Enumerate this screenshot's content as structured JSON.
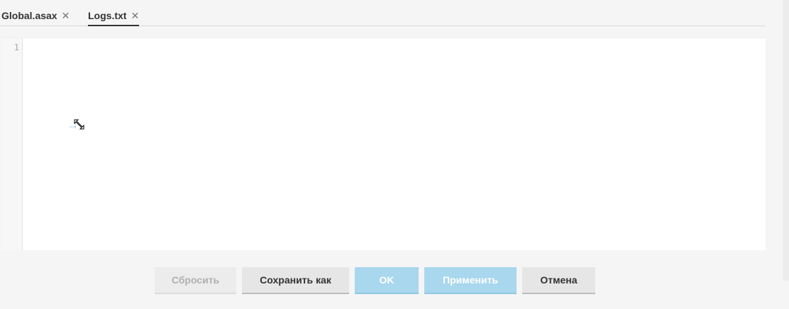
{
  "tabs": [
    {
      "label": "Global.asax",
      "close_icon": "close-icon",
      "active": false
    },
    {
      "label": "Logs.txt",
      "close_icon": "close-icon",
      "active": true
    }
  ],
  "editor": {
    "line_numbers": [
      "1"
    ],
    "content": "",
    "cursor_icon": "resize-cursor-icon"
  },
  "buttons": {
    "reset": {
      "label": "Сбросить",
      "enabled": false
    },
    "save_as": {
      "label": "Сохранить как",
      "enabled": true
    },
    "ok": {
      "label": "OK",
      "enabled": false
    },
    "apply": {
      "label": "Применить",
      "enabled": false
    },
    "cancel": {
      "label": "Отмена",
      "enabled": true
    }
  },
  "colors": {
    "primary_disabled": "#a8d7ee",
    "secondary_button": "#e6e6e6",
    "text": "#333333",
    "background": "#f5f5f5"
  }
}
